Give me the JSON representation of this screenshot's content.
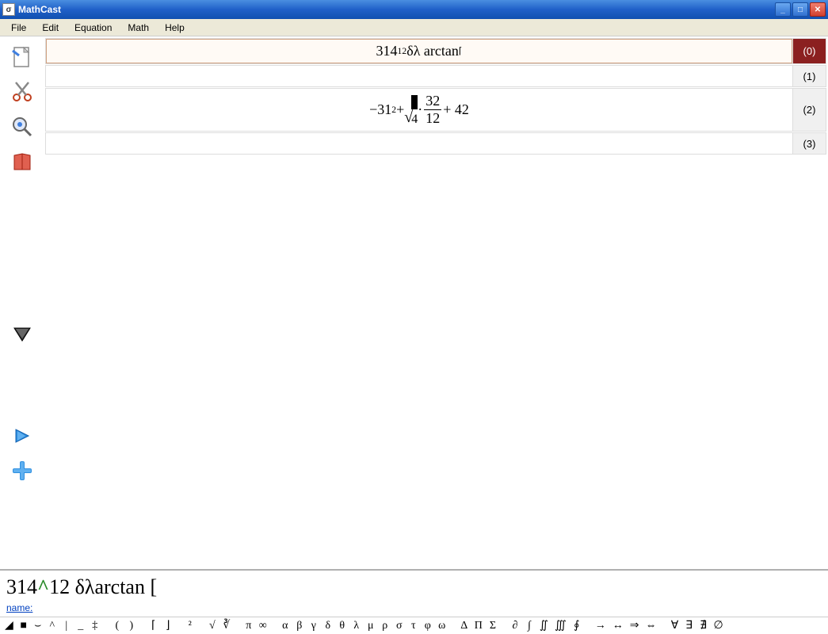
{
  "window": {
    "title": "MathCast",
    "buttons": {
      "minimize": "_",
      "maximize": "□",
      "close": "✕"
    }
  },
  "menu": {
    "file": "File",
    "edit": "Edit",
    "equation": "Equation",
    "math": "Math",
    "help": "Help"
  },
  "left_tools": {
    "new": "new-doc-icon",
    "cut": "scissors-icon",
    "view": "magnify-icon",
    "book": "book-icon",
    "dropdown": "dropdown-triangle-icon",
    "nav_right": "nav-right-icon",
    "add": "plus-icon"
  },
  "equations": {
    "row0": {
      "num_label": "(0)",
      "base": "314",
      "sup": "12",
      "mid": "δλ arctan",
      "tail": "⌈"
    },
    "row1": {
      "num_label": "(1)"
    },
    "row2": {
      "num_label": "(2)",
      "lead": "−31",
      "lead_sup": "2",
      "plus1": " + ",
      "sqrt_arg": "4",
      "dot": " · ",
      "frac_num": "32",
      "frac_den": "12",
      "plus2": " + 42"
    },
    "row3": {
      "num_label": "(3)"
    }
  },
  "input": {
    "part1": "314",
    "caret": "^",
    "part2": "12 δλarctan [",
    "name_label": "name:"
  },
  "symbols": [
    "◢",
    "■",
    "⌣",
    "^",
    "|",
    "_",
    "‡",
    "",
    "(",
    ")",
    "",
    "⌈",
    "⌋",
    "",
    "²",
    "",
    "√",
    "∛",
    "",
    "π",
    "∞",
    "",
    "α",
    "β",
    "γ",
    "δ",
    "θ",
    "λ",
    "μ",
    "ρ",
    "σ",
    "τ",
    "φ",
    "ω",
    "",
    "Δ",
    "Π",
    "Σ",
    "",
    "∂",
    "∫",
    "∬",
    "∭",
    "∮",
    "",
    "→",
    "↔",
    "⇒",
    "⇔",
    "",
    "∀",
    "∃",
    "∄",
    "∅"
  ]
}
